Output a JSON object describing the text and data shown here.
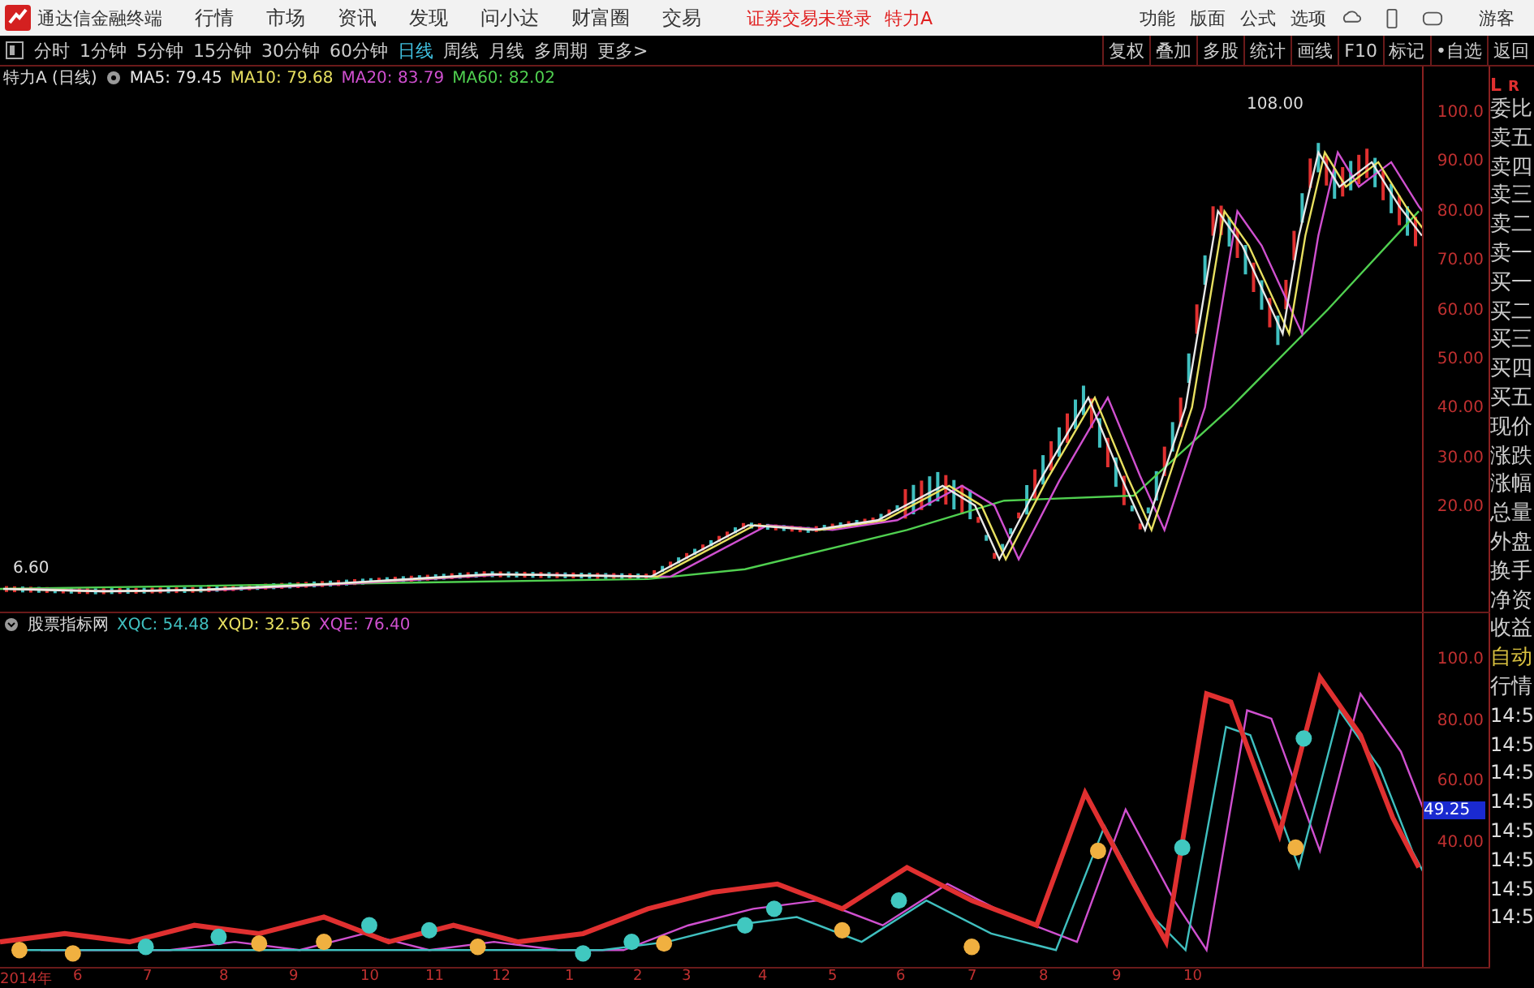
{
  "app_bar": {
    "title": "通达信金融终端",
    "menu": [
      "行情",
      "市场",
      "资讯",
      "发现",
      "问小达",
      "财富圈",
      "交易"
    ],
    "notice": "证券交易未登录",
    "stock": "特力A",
    "right_menu": [
      "功能",
      "版面",
      "公式",
      "选项"
    ],
    "user": "游客"
  },
  "period_tabs": [
    {
      "label": "分时",
      "selected": false
    },
    {
      "label": "1分钟",
      "selected": false
    },
    {
      "label": "5分钟",
      "selected": false
    },
    {
      "label": "15分钟",
      "selected": false
    },
    {
      "label": "30分钟",
      "selected": false
    },
    {
      "label": "60分钟",
      "selected": false
    },
    {
      "label": "日线",
      "selected": true
    },
    {
      "label": "周线",
      "selected": false
    },
    {
      "label": "月线",
      "selected": false
    },
    {
      "label": "多周期",
      "selected": false
    },
    {
      "label": "更多>",
      "selected": false
    }
  ],
  "tool_buttons": [
    "复权",
    "叠加",
    "多股",
    "统计",
    "画线",
    "F10",
    "标记",
    "•自选",
    "返回"
  ],
  "main_chart": {
    "title": "特力A (日线)",
    "legend": [
      {
        "label": "MA5: 79.45",
        "color": "#e8e8e8"
      },
      {
        "label": "MA10: 79.68",
        "color": "#e8e060"
      },
      {
        "label": "MA20: 83.79",
        "color": "#d050d0"
      },
      {
        "label": "MA60: 82.02",
        "color": "#50d050"
      }
    ],
    "high_label": "108.00",
    "low_label": "6.60",
    "axis": [
      "100.0",
      "90.00",
      "80.00",
      "70.00",
      "60.00",
      "50.00",
      "40.00",
      "30.00",
      "20.00"
    ]
  },
  "indicator": {
    "title": "股票指标网",
    "legend": [
      {
        "label": "XQC: 54.48",
        "color": "#40c0c0"
      },
      {
        "label": "XQD: 32.56",
        "color": "#e8e060"
      },
      {
        "label": "XQE: 76.40",
        "color": "#d050d0"
      }
    ],
    "axis": [
      "100.0",
      "80.00",
      "60.00",
      "40.00"
    ],
    "current": "49.25"
  },
  "time_axis": [
    "2014年",
    "6",
    "7",
    "8",
    "9",
    "10",
    "11",
    "12",
    "1",
    "2",
    "3",
    "4",
    "5",
    "6",
    "7",
    "8",
    "9",
    "10"
  ],
  "quote_panel": {
    "header": [
      "L",
      "R"
    ],
    "labels": [
      "委比",
      "卖五",
      "卖四",
      "卖三",
      "卖二",
      "卖一",
      "买一",
      "买二",
      "买三",
      "买四",
      "买五",
      "现价",
      "涨跌",
      "涨幅",
      "总量",
      "外盘",
      "换手",
      "净资",
      "收益"
    ],
    "lower": [
      "自动",
      "行情"
    ],
    "times": [
      "14:5",
      "14:5",
      "14:5",
      "14:5",
      "14:5",
      "14:5",
      "14:5",
      "14:5"
    ]
  }
}
